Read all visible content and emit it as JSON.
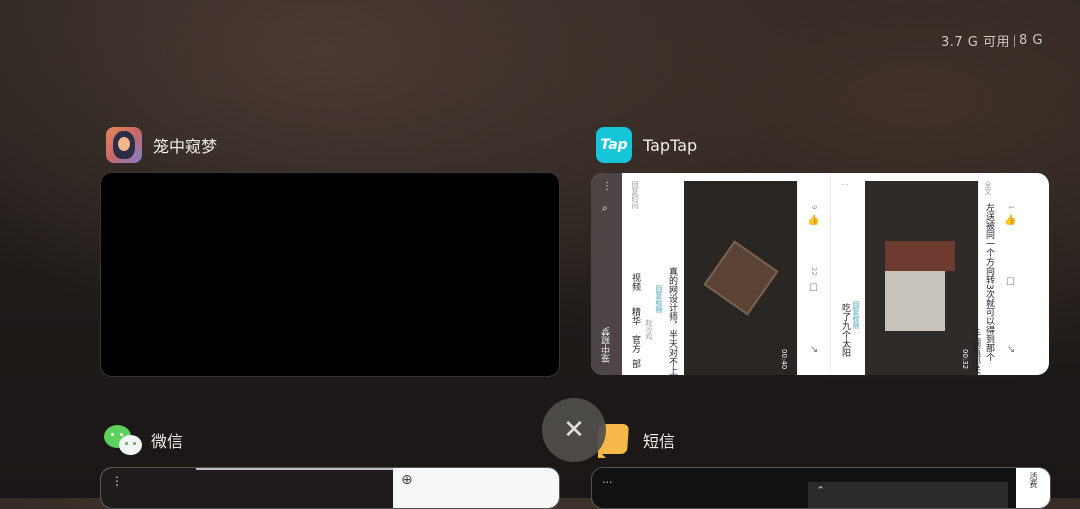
{
  "memory": {
    "available": "3.7 G 可用",
    "total": "8 G"
  },
  "apps": [
    {
      "name": "笼中窥梦",
      "icon": "cage-dream-app-icon"
    },
    {
      "name": "TapTap",
      "icon": "taptap-app-icon",
      "icon_text": "Tap"
    },
    {
      "name": "微信",
      "icon": "wechat-app-icon"
    },
    {
      "name": "短信",
      "icon": "sms-app-icon"
    }
  ],
  "taptap_preview": {
    "game_tag": "笼中窥梦",
    "tabs": [
      "官方",
      "精华",
      "视频"
    ],
    "tab_prefix": "部",
    "filter": "回复时间",
    "posts": [
      {
        "title": "真的网设计师，半天对不上",
        "author": "赵沙鸡",
        "badge": "回复权限",
        "likes": "9",
        "comments": "22",
        "duration": "00:40"
      },
      {
        "title": "吃了九个太阳",
        "author": "",
        "badge": "回复权限",
        "likes": "1",
        "comments": "",
        "duration": "00:32"
      }
    ],
    "post3_line1": "手调瓶那关",
    "post3_line2": "左送被同一个方向转3次就可以得到那个",
    "post3_more": "全文"
  },
  "sms_preview": {
    "side_label": "活费"
  },
  "colors": {
    "taptap": "#16c6d8",
    "wechat": "#5ed05e",
    "sms": "#f7b84a"
  }
}
